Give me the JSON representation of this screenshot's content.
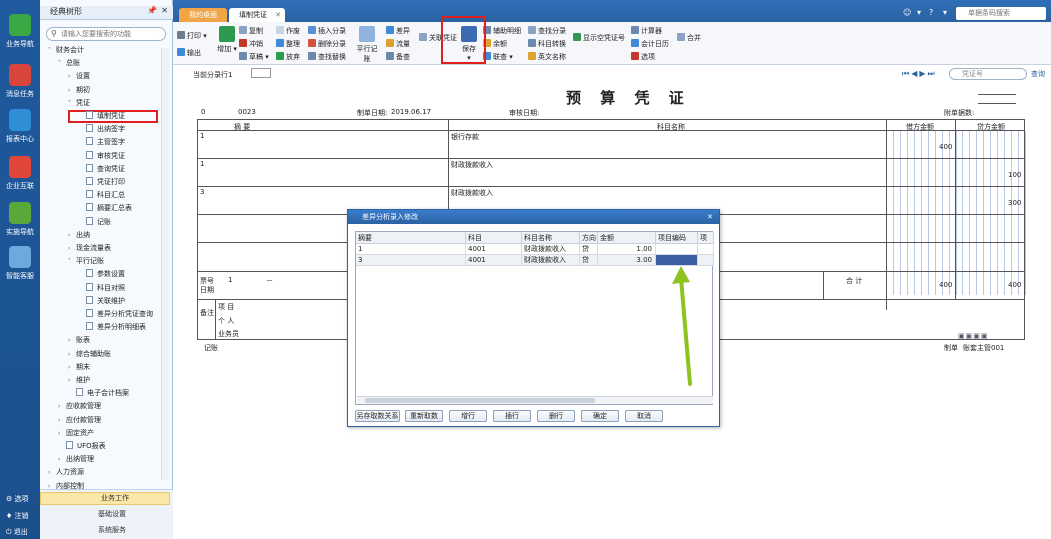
{
  "rail": {
    "items": [
      "业务导航",
      "消息任务",
      "报表中心",
      "企业互联",
      "实施导航",
      "智能客服"
    ],
    "bottom": [
      "选项",
      "注销",
      "退出"
    ]
  },
  "nav": {
    "title": "经典树形",
    "search_placeholder": "请输入您要搜索的功能",
    "tree": [
      {
        "label": "财务会计",
        "indent": 0,
        "kind": "folder",
        "arrow": "down"
      },
      {
        "label": "总账",
        "indent": 1,
        "kind": "folder",
        "arrow": "down"
      },
      {
        "label": "设置",
        "indent": 2,
        "kind": "folder",
        "arrow": "right"
      },
      {
        "label": "期初",
        "indent": 2,
        "kind": "folder",
        "arrow": "right"
      },
      {
        "label": "凭证",
        "indent": 2,
        "kind": "folder",
        "arrow": "down"
      },
      {
        "label": "填制凭证",
        "indent": 3,
        "kind": "doc"
      },
      {
        "label": "出纳签字",
        "indent": 3,
        "kind": "doc"
      },
      {
        "label": "主管签字",
        "indent": 3,
        "kind": "doc"
      },
      {
        "label": "审核凭证",
        "indent": 3,
        "kind": "doc"
      },
      {
        "label": "查询凭证",
        "indent": 3,
        "kind": "doc"
      },
      {
        "label": "凭证打印",
        "indent": 3,
        "kind": "doc"
      },
      {
        "label": "科目汇总",
        "indent": 3,
        "kind": "doc"
      },
      {
        "label": "摘要汇总表",
        "indent": 3,
        "kind": "doc"
      },
      {
        "label": "记账",
        "indent": 3,
        "kind": "doc"
      },
      {
        "label": "出纳",
        "indent": 2,
        "kind": "folder",
        "arrow": "right"
      },
      {
        "label": "现金流量表",
        "indent": 2,
        "kind": "folder",
        "arrow": "right"
      },
      {
        "label": "平行记账",
        "indent": 2,
        "kind": "folder",
        "arrow": "down"
      },
      {
        "label": "参数设置",
        "indent": 3,
        "kind": "doc"
      },
      {
        "label": "科目对照",
        "indent": 3,
        "kind": "doc"
      },
      {
        "label": "关联维护",
        "indent": 3,
        "kind": "doc"
      },
      {
        "label": "差异分析凭证查询",
        "indent": 3,
        "kind": "doc"
      },
      {
        "label": "差异分析明细表",
        "indent": 3,
        "kind": "doc"
      },
      {
        "label": "账表",
        "indent": 2,
        "kind": "folder",
        "arrow": "right"
      },
      {
        "label": "综合辅助账",
        "indent": 2,
        "kind": "folder",
        "arrow": "right"
      },
      {
        "label": "期末",
        "indent": 2,
        "kind": "folder",
        "arrow": "right"
      },
      {
        "label": "维护",
        "indent": 2,
        "kind": "folder",
        "arrow": "right"
      },
      {
        "label": "电子会计档案",
        "indent": 2,
        "kind": "doc"
      },
      {
        "label": "应收款管理",
        "indent": 1,
        "kind": "folder",
        "arrow": "right"
      },
      {
        "label": "应付款管理",
        "indent": 1,
        "kind": "folder",
        "arrow": "right"
      },
      {
        "label": "固定资产",
        "indent": 1,
        "kind": "folder",
        "arrow": "right"
      },
      {
        "label": "UFO报表",
        "indent": 1,
        "kind": "doc"
      },
      {
        "label": "出纳管理",
        "indent": 1,
        "kind": "folder",
        "arrow": "right"
      },
      {
        "label": "人力资源",
        "indent": 0,
        "kind": "folder",
        "arrow": "right"
      },
      {
        "label": "内部控制",
        "indent": 0,
        "kind": "folder",
        "arrow": "right"
      }
    ],
    "footer": [
      "业务工作",
      "基础设置",
      "系统服务"
    ]
  },
  "tabs": [
    {
      "label": "我的桌面"
    },
    {
      "label": "填制凭证"
    }
  ],
  "top_search_placeholder": "单据条码搜索",
  "toolbar": {
    "print": "打印",
    "export": "输出",
    "add": "增加",
    "copy": "复制",
    "reverse": "冲销",
    "draft": "草稿",
    "void": "作废",
    "tidy": "整理",
    "abandon": "放弃",
    "insert_entry": "插入分录",
    "delete_entry": "删除分录",
    "find_replace": "查找替换",
    "parallel": "平行记账",
    "diff": "差异",
    "flow": "流量",
    "check": "备查",
    "link": "关联凭证",
    "save": "保存",
    "aux_detail": "辅助明细",
    "balance": "余额",
    "linked_query": "联查",
    "find_entry": "查找分录",
    "subject_convert": "科目转换",
    "eng_name": "英文名称",
    "show_blank": "显示空凭证号",
    "calculator": "计算器",
    "calendar": "会计日历",
    "options": "选项",
    "merge": "合并"
  },
  "voucher": {
    "current_entry_label": "当前分录行1",
    "search_placeholder": "凭证号",
    "query": "查询",
    "title": "预 算 凭 证",
    "number": "0",
    "seq": "0023",
    "date_label": "制单日期:",
    "date": "2019.06.17",
    "audit_label": "审核日期:",
    "attach_label": "附单据数:",
    "col_summary": "摘 要",
    "col_subject": "科目名称",
    "col_debit": "借方金额",
    "col_credit": "贷方金额",
    "rows": [
      {
        "summary": "1",
        "subject": "银行存款",
        "debit": "400",
        "credit": ""
      },
      {
        "summary": "1",
        "subject": "财政拨款收入",
        "debit": "",
        "credit": "100"
      },
      {
        "summary": "3",
        "subject": "财政拨款收入",
        "debit": "",
        "credit": "300"
      }
    ],
    "ticket_label": "票号",
    "date2_label": "日期",
    "qty_label": "1",
    "dash": "－",
    "total_label": "合 计",
    "total_debit": "400",
    "total_credit": "400",
    "remark_label": "备注",
    "project_label": "项 目",
    "person_label": "个 人",
    "salesman_label": "业务员",
    "bookkeeping": "记账",
    "maker_label": "制单",
    "maker": "账套主管001"
  },
  "dialog": {
    "title": "差异分析录入修改",
    "columns": [
      "摘要",
      "科目",
      "科目名称",
      "方向",
      "金额",
      "项目编码",
      "项目"
    ],
    "rows": [
      {
        "summary": "1",
        "code": "4001",
        "name": "财政拨款收入",
        "dir": "贷",
        "amount": "1.00"
      },
      {
        "summary": "3",
        "code": "4001",
        "name": "财政拨款收入",
        "dir": "贷",
        "amount": "3.00"
      }
    ],
    "buttons": [
      "另存取数关系",
      "重新取数",
      "增行",
      "插行",
      "删行",
      "确定",
      "取消"
    ]
  },
  "colors": {
    "accent": "#2a62a3",
    "highlight": "#e02020",
    "arrow": "#8dc21f",
    "active_cell": "#3c5fa4"
  }
}
